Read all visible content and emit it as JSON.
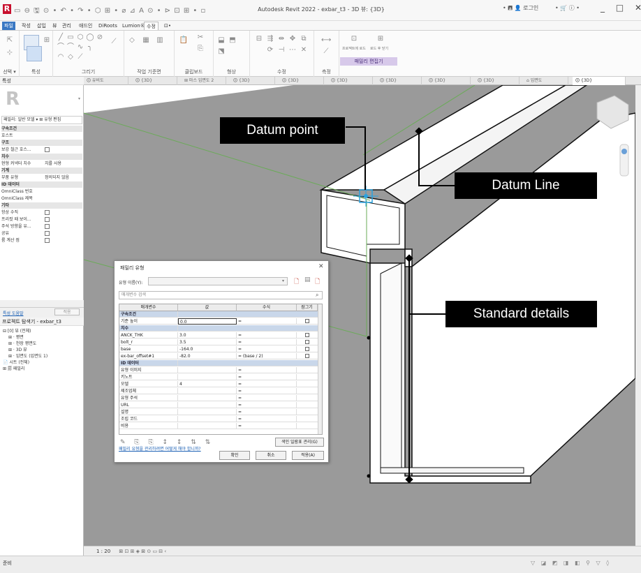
{
  "titlebar": {
    "window_title": "Autodesk Revit 2022 - exbar_t3 - 3D 뷰: {3D}",
    "user": "• 🖪 👤 로그인",
    "help": "• 🛒 ⓘ •",
    "controls": "_ □ ✕"
  },
  "ribbon": {
    "tabs": [
      "파일",
      "작성",
      "삽입",
      "뷰",
      "관리",
      "애드인",
      "DiRoots",
      "Lumion®",
      "수정",
      "⊡•"
    ],
    "groups": [
      "선택 ▾",
      "특성",
      "그리기",
      "작업 기준면",
      "클립보드",
      "형상",
      "수정",
      "측정",
      "패밀리 편집기"
    ],
    "context_label": "패밀리 편집기"
  },
  "properties": {
    "header": "특성",
    "family_selector": "패밀리: 일반 모델   ▾  ⊞ 유형 편집",
    "rows": [
      {
        "label": "구속조건",
        "type": "cat"
      },
      {
        "label": "호스트",
        "type": "row"
      },
      {
        "label": "구조",
        "type": "cat"
      },
      {
        "label": "보강 철근 호스...",
        "type": "row",
        "check": true
      },
      {
        "label": "치수",
        "type": "cat"
      },
      {
        "label": "현형 커넥터 치수",
        "value": "치를 사용",
        "type": "row"
      },
      {
        "label": "기계",
        "type": "cat"
      },
      {
        "label": "부품 유형",
        "value": "정의되지 않음",
        "type": "row"
      },
      {
        "label": "ID 데이터",
        "type": "cat"
      },
      {
        "label": "OmniClass 번호",
        "type": "row"
      },
      {
        "label": "OmniClass 제목",
        "type": "row"
      },
      {
        "label": "기타",
        "type": "cat"
      },
      {
        "label": "항상 수직",
        "type": "row",
        "check": true
      },
      {
        "label": "프리컷 때 보이...",
        "type": "row",
        "check": true
      },
      {
        "label": "주석 방향을 유...",
        "type": "row",
        "check": true
      },
      {
        "label": "공유",
        "type": "row",
        "check": true
      },
      {
        "label": "룸 계산 점",
        "type": "row",
        "check": true
      }
    ],
    "help_link": "특성 도움말",
    "apply": "적용"
  },
  "browser": {
    "header": "프로젝트 탐색기 - exbar_t3",
    "items": [
      "⊟ [0] 뷰 (전체)",
      "⊞ · 평면",
      "⊞ · 천장 평면도",
      "⊞ · 3D 뷰",
      "⊞ · 입면도 (입면도 1)",
      "📄 시트 (전체)",
      "⊞ 🗐 패밀리"
    ]
  },
  "viewtabs": [
    "🛈 유비도",
    "🛈 {3D}",
    "⊞ 마스 입면도 2",
    "🛈 {3D}",
    "🛈 {3D}",
    "🛈 {3D}",
    "🛈 {3D}",
    "🛈 {3D}",
    "🛈 {3D}",
    "⌂ 입면도",
    "🛈 {3D}"
  ],
  "callouts": {
    "datum_point": "Datum point",
    "datum_line": "Datum Line",
    "standard_details": "Standard details"
  },
  "dialog": {
    "title": "패밀리 유형",
    "type_name_label": "유형 이름(Y):",
    "search_placeholder": "매개변수 검색",
    "columns": [
      "매개변수",
      "값",
      "수식",
      "잠그기"
    ],
    "rows": [
      {
        "name": "구속조건",
        "type": "cat"
      },
      {
        "name": "기준 높이",
        "value": "0.0",
        "formula": "=",
        "lock": true
      },
      {
        "name": "치수",
        "type": "cat"
      },
      {
        "name": "ANCK_THK",
        "value": "3.0",
        "formula": "=",
        "lock": true
      },
      {
        "name": "bolt_r",
        "value": "3.5",
        "formula": "=",
        "lock": true
      },
      {
        "name": "base",
        "value": "-164.0",
        "formula": "=",
        "lock": true
      },
      {
        "name": "ex-bar_offset#1",
        "value": "-82.0",
        "formula": "= (base / 2)",
        "lock": true
      },
      {
        "name": "ID 데이터",
        "type": "cat"
      },
      {
        "name": "유형 이미지",
        "value": "",
        "formula": "="
      },
      {
        "name": "키노트",
        "value": "",
        "formula": "="
      },
      {
        "name": "모델",
        "value": "4",
        "formula": "="
      },
      {
        "name": "제조업체",
        "value": "",
        "formula": "="
      },
      {
        "name": "유형 주석",
        "value": "",
        "formula": "="
      },
      {
        "name": "URL",
        "value": "",
        "formula": "="
      },
      {
        "name": "설명",
        "value": "",
        "formula": "="
      },
      {
        "name": "조립 코드",
        "value": "",
        "formula": "="
      },
      {
        "name": "비용",
        "value": "",
        "formula": "="
      }
    ],
    "tools": "✎ ⎘ ⎘ ↕ ↕ ⇅ ⇅",
    "manage_lookup": "색인 일람표 관리(G)",
    "help_link": "패밀리 유형을 관리하려면 어떻게 해야 합니까?",
    "ok": "확인",
    "cancel": "취소",
    "apply": "적용(A)"
  },
  "viewbar": {
    "scale": "1 : 20",
    "icons": "⊠ ⊡ ⊞ ◈ ⊠ ⊙ ▭ ⊟ ‹"
  },
  "status": {
    "text": "준비",
    "right": "▽ ◪ ◩ ◨ ◧ ⚲ ▽ ◊"
  },
  "colors": {
    "viewport_gray": "#9a9a9a",
    "accent_blue": "#3a78c3",
    "datum_green": "#6aab57"
  }
}
